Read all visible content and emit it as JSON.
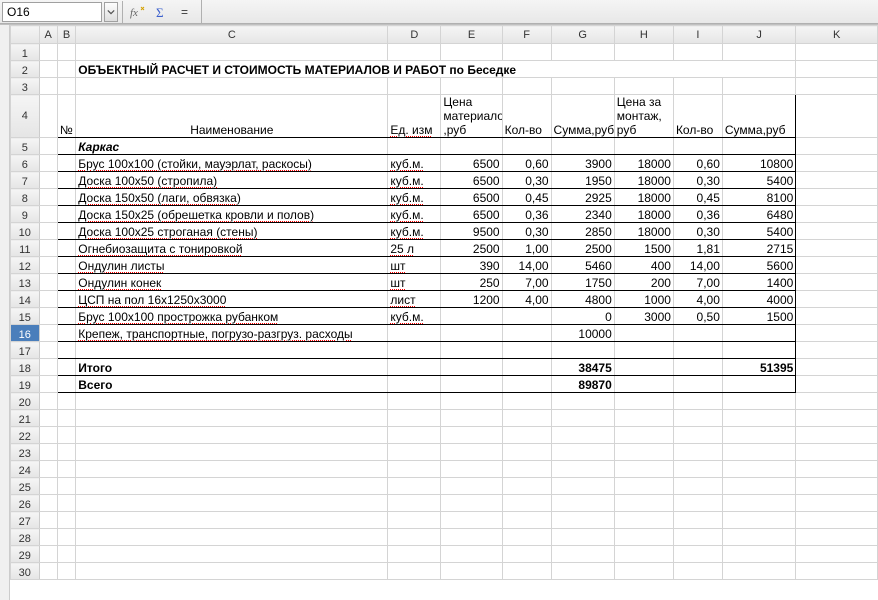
{
  "name_box": "O16",
  "col_headers": [
    "A",
    "B",
    "C",
    "D",
    "E",
    "F",
    "G",
    "H",
    "I",
    "J",
    "K"
  ],
  "row_numbers": [
    1,
    2,
    3,
    4,
    5,
    6,
    7,
    8,
    9,
    10,
    11,
    12,
    13,
    14,
    15,
    16,
    17,
    18,
    19,
    20,
    21,
    22,
    23,
    24,
    25,
    26,
    27,
    28,
    29,
    30
  ],
  "selected_row": 16,
  "title": "ОБЪЕКТНЫЙ РАСЧЕТ И СТОИМОСТЬ МАТЕРИАЛОВ И РАБОТ по Беседке",
  "headers": {
    "num": "№",
    "name": "Наименование",
    "unit": "Ед. изм",
    "price_mat": "Цена материалов ,руб",
    "qty1": "Кол-во",
    "sum1": "Сумма,руб",
    "price_mount": "Цена  за монтаж, руб",
    "qty2": "Кол-во",
    "sum2": "Сумма,руб"
  },
  "section1": "Каркас",
  "rows": [
    {
      "name": "Брус 100х100  (стойки, мауэрлат, раскосы)",
      "unit": "куб.м.",
      "p": "6500",
      "q": "0,60",
      "s": "3900",
      "pm": "18000",
      "q2": "0,60",
      "s2": "10800"
    },
    {
      "name": "Доска 100х50  (стропила)",
      "unit": "куб.м.",
      "p": "6500",
      "q": "0,30",
      "s": "1950",
      "pm": "18000",
      "q2": "0,30",
      "s2": "5400"
    },
    {
      "name": "Доска 150х50 (лаги, обвязка)",
      "unit": "куб.м.",
      "p": "6500",
      "q": "0,45",
      "s": "2925",
      "pm": "18000",
      "q2": "0,45",
      "s2": "8100"
    },
    {
      "name": "Доска 150х25 (обрешетка кровли и полов)",
      "unit": "куб.м.",
      "p": "6500",
      "q": "0,36",
      "s": "2340",
      "pm": "18000",
      "q2": "0,36",
      "s2": "6480"
    },
    {
      "name": "Доска 100х25 строганая (стены)",
      "unit": "куб.м.",
      "p": "9500",
      "q": "0,30",
      "s": "2850",
      "pm": "18000",
      "q2": "0,30",
      "s2": "5400"
    },
    {
      "name": "Огнебиозащита с тонировкой",
      "unit": "25 л",
      "p": "2500",
      "q": "1,00",
      "s": "2500",
      "pm": "1500",
      "q2": "1,81",
      "s2": "2715"
    },
    {
      "name": "Ондулин листы",
      "unit": "шт",
      "p": "390",
      "q": "14,00",
      "s": "5460",
      "pm": "400",
      "q2": "14,00",
      "s2": "5600"
    },
    {
      "name": "Ондулин  конек",
      "unit": "шт",
      "p": "250",
      "q": "7,00",
      "s": "1750",
      "pm": "200",
      "q2": "7,00",
      "s2": "1400"
    },
    {
      "name": "ЦСП на пол 16х1250х3000",
      "unit": "лист",
      "p": "1200",
      "q": "4,00",
      "s": "4800",
      "pm": "1000",
      "q2": "4,00",
      "s2": "4000"
    },
    {
      "name": "Брус 100х100 прострожка рубанком",
      "unit": "куб.м.",
      "p": "",
      "q": "",
      "s": "0",
      "pm": "3000",
      "q2": "0,50",
      "s2": "1500"
    },
    {
      "name": "Крепеж, транспортные, погрузо-разгруз. расходы",
      "unit": "",
      "p": "",
      "q": "",
      "s": "10000",
      "pm": "",
      "q2": "",
      "s2": ""
    }
  ],
  "totals": {
    "itogo_label": "Итого",
    "itogo_g": "38475",
    "itogo_j": "51395",
    "vsego_label": "Всего",
    "vsego_g": "89870"
  },
  "chart_data": {
    "type": "table",
    "title": "ОБЪЕКТНЫЙ РАСЧЕТ И СТОИМОСТЬ МАТЕРИАЛОВ И РАБОТ по Беседке",
    "columns": [
      "Наименование",
      "Ед. изм",
      "Цена материалов ,руб",
      "Кол-во",
      "Сумма,руб",
      "Цена за монтаж, руб",
      "Кол-во",
      "Сумма,руб"
    ],
    "rows": [
      [
        "Брус 100х100 (стойки, мауэрлат, раскосы)",
        "куб.м.",
        6500,
        0.6,
        3900,
        18000,
        0.6,
        10800
      ],
      [
        "Доска 100х50 (стропила)",
        "куб.м.",
        6500,
        0.3,
        1950,
        18000,
        0.3,
        5400
      ],
      [
        "Доска 150х50 (лаги, обвязка)",
        "куб.м.",
        6500,
        0.45,
        2925,
        18000,
        0.45,
        8100
      ],
      [
        "Доска 150х25 (обрешетка кровли и полов)",
        "куб.м.",
        6500,
        0.36,
        2340,
        18000,
        0.36,
        6480
      ],
      [
        "Доска 100х25 строганая (стены)",
        "куб.м.",
        9500,
        0.3,
        2850,
        18000,
        0.3,
        5400
      ],
      [
        "Огнебиозащита с тонировкой",
        "25 л",
        2500,
        1.0,
        2500,
        1500,
        1.81,
        2715
      ],
      [
        "Ондулин листы",
        "шт",
        390,
        14.0,
        5460,
        400,
        14.0,
        5600
      ],
      [
        "Ондулин конек",
        "шт",
        250,
        7.0,
        1750,
        200,
        7.0,
        1400
      ],
      [
        "ЦСП на пол 16х1250х3000",
        "лист",
        1200,
        4.0,
        4800,
        1000,
        4.0,
        4000
      ],
      [
        "Брус 100х100 прострожка рубанком",
        "куб.м.",
        null,
        null,
        0,
        3000,
        0.5,
        1500
      ],
      [
        "Крепеж, транспортные, погрузо-разгруз. расходы",
        "",
        null,
        null,
        10000,
        null,
        null,
        null
      ]
    ],
    "totals": {
      "Итого Сумма,руб (материалы)": 38475,
      "Итого Сумма,руб (монтаж)": 51395,
      "Всего": 89870
    }
  }
}
